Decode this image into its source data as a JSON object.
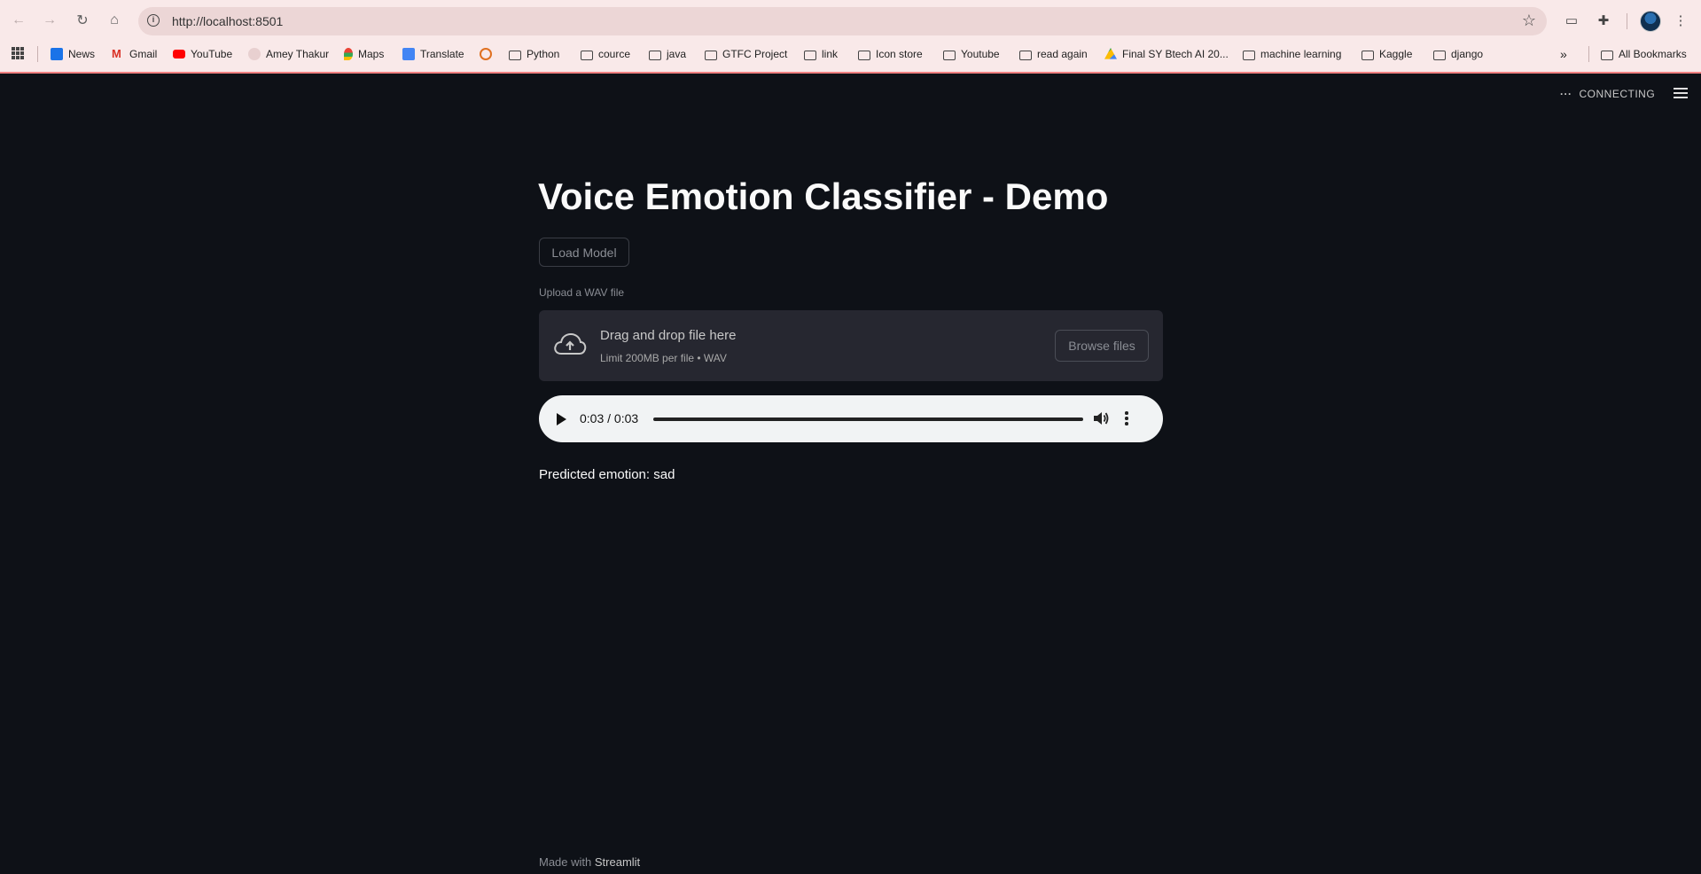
{
  "browser": {
    "url": "http://localhost:8501",
    "bookmarks": [
      {
        "label": "News",
        "icon": "news-icon"
      },
      {
        "label": "Gmail",
        "icon": "gmail-icon"
      },
      {
        "label": "YouTube",
        "icon": "youtube-icon"
      },
      {
        "label": "Amey Thakur",
        "icon": "profile-icon"
      },
      {
        "label": "Maps",
        "icon": "maps-icon"
      },
      {
        "label": "Translate",
        "icon": "translate-icon"
      },
      {
        "label": "",
        "icon": "site-icon"
      },
      {
        "label": "Python",
        "icon": "folder-icon"
      },
      {
        "label": "cource",
        "icon": "folder-icon"
      },
      {
        "label": "java",
        "icon": "folder-icon"
      },
      {
        "label": "GTFC Project",
        "icon": "folder-icon"
      },
      {
        "label": "link",
        "icon": "folder-icon"
      },
      {
        "label": "Icon store",
        "icon": "folder-icon"
      },
      {
        "label": "Youtube",
        "icon": "folder-icon"
      },
      {
        "label": "read again",
        "icon": "folder-icon"
      },
      {
        "label": "Final SY Btech AI 20...",
        "icon": "drive-icon"
      },
      {
        "label": "machine learning",
        "icon": "folder-icon"
      },
      {
        "label": "Kaggle",
        "icon": "folder-icon"
      },
      {
        "label": "django",
        "icon": "folder-icon"
      }
    ],
    "overflow_label": "»",
    "all_bookmarks": "All Bookmarks"
  },
  "app": {
    "status": "CONNECTING",
    "title": "Voice Emotion Classifier - Demo",
    "load_button": "Load Model",
    "upload_label": "Upload a WAV file",
    "dropzone_main": "Drag and drop file here",
    "dropzone_sub": "Limit 200MB per file • WAV",
    "browse_button": "Browse files",
    "audio_time": "0:03 / 0:03",
    "audio_progress": 1.0,
    "prediction": "Predicted emotion: sad",
    "footer_prefix": "Made with",
    "footer_brand": "Streamlit"
  }
}
